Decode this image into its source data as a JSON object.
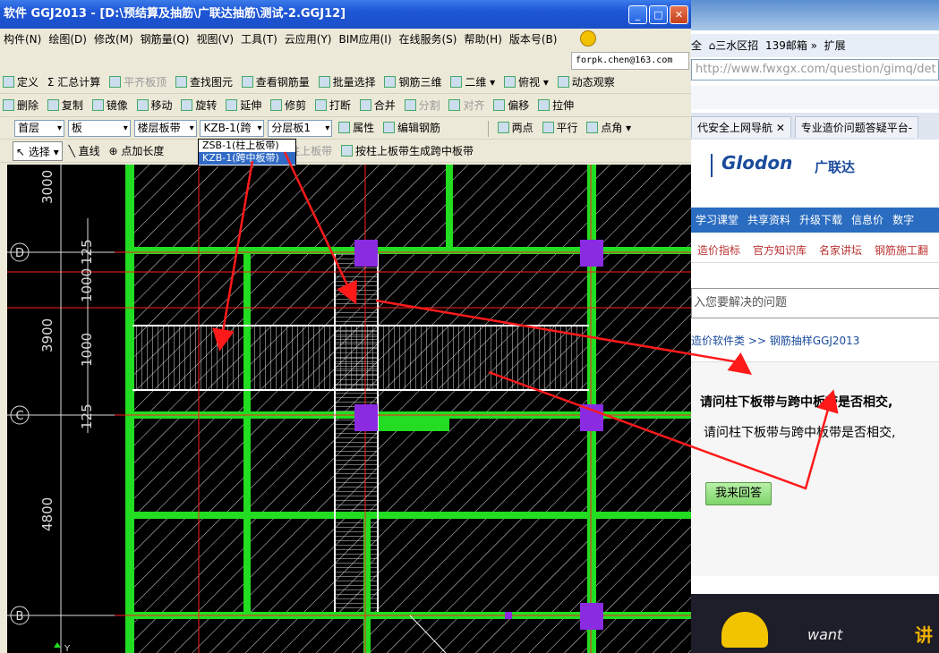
{
  "app": {
    "title": "软件 GGJ2013 - [D:\\预结算及抽筋\\广联达抽筋\\测试-2.GGJ12]",
    "menu": [
      "构件(N)",
      "绘图(D)",
      "修改(M)",
      "钢筋量(Q)",
      "视图(V)",
      "工具(T)",
      "云应用(Y)",
      "BIM应用(I)",
      "在线服务(S)",
      "帮助(H)",
      "版本号(B)"
    ],
    "email": "forpk.chen@163.com",
    "toolbar1": [
      "定义",
      "汇总计算",
      "平齐板顶",
      "查找图元",
      "查看钢筋量",
      "批量选择",
      "钢筋三维",
      "二维",
      "俯视",
      "动态观察"
    ],
    "toolbar2": [
      "删除",
      "复制",
      "镜像",
      "移动",
      "旋转",
      "延伸",
      "修剪",
      "打断",
      "合并",
      "分割",
      "对齐",
      "偏移",
      "拉伸"
    ],
    "toolbar3": {
      "floor": "首层",
      "type": "板",
      "category": "楼层板带",
      "component": "KZB-1(跨",
      "layer": "分层板1",
      "properties": "属性",
      "edit_rebar": "编辑钢筋",
      "two_points": "两点",
      "parallel": "平行",
      "point_angle": "点角"
    },
    "toolbar4": {
      "select": "选择",
      "line": "直线",
      "point_length": "点加长度",
      "gen_under_col": "生成柱上板带",
      "gen_mid": "按柱上板带生成跨中板带"
    },
    "dropdown": [
      "ZSB-1(柱上板带)",
      "KZB-1(跨中板带)"
    ],
    "cad": {
      "dims": [
        "3000",
        "3900",
        "4800",
        "1000",
        "1000",
        "125",
        "125"
      ],
      "axes": [
        "D",
        "C",
        "B"
      ],
      "axis_y": "Y"
    }
  },
  "browser": {
    "address": "http://www.fwxgx.com/question/gimq/det",
    "bar1": [
      "全",
      "三水区招",
      "139邮箱",
      "扩展"
    ],
    "tabs": [
      "代安全上网导航",
      "专业造价问题答疑平台-"
    ],
    "logo": "Glodon",
    "logo_cn": "广联达",
    "nav": [
      "学习课堂",
      "共享资料",
      "升级下载",
      "信息价",
      "数字"
    ],
    "subnav": [
      "造价指标",
      "官方知识库",
      "名家讲坛",
      "钢筋施工翻"
    ],
    "search_placeholder": "入您要解决的问题",
    "breadcrumb": [
      "造价软件类",
      "钢筋抽样GGJ2013"
    ],
    "question_title": "请问柱下板带与跨中板带是否相交,",
    "question_body": "请问柱下板带与跨中板带是否相交,",
    "answer_button": "我来回答",
    "ad_text": "want",
    "ad_cn": "讲"
  },
  "colors": {
    "beam": "#22dd22",
    "column": "#8a2be2",
    "arrow": "#ff1a1a",
    "titlebar": "#1e56d6"
  }
}
